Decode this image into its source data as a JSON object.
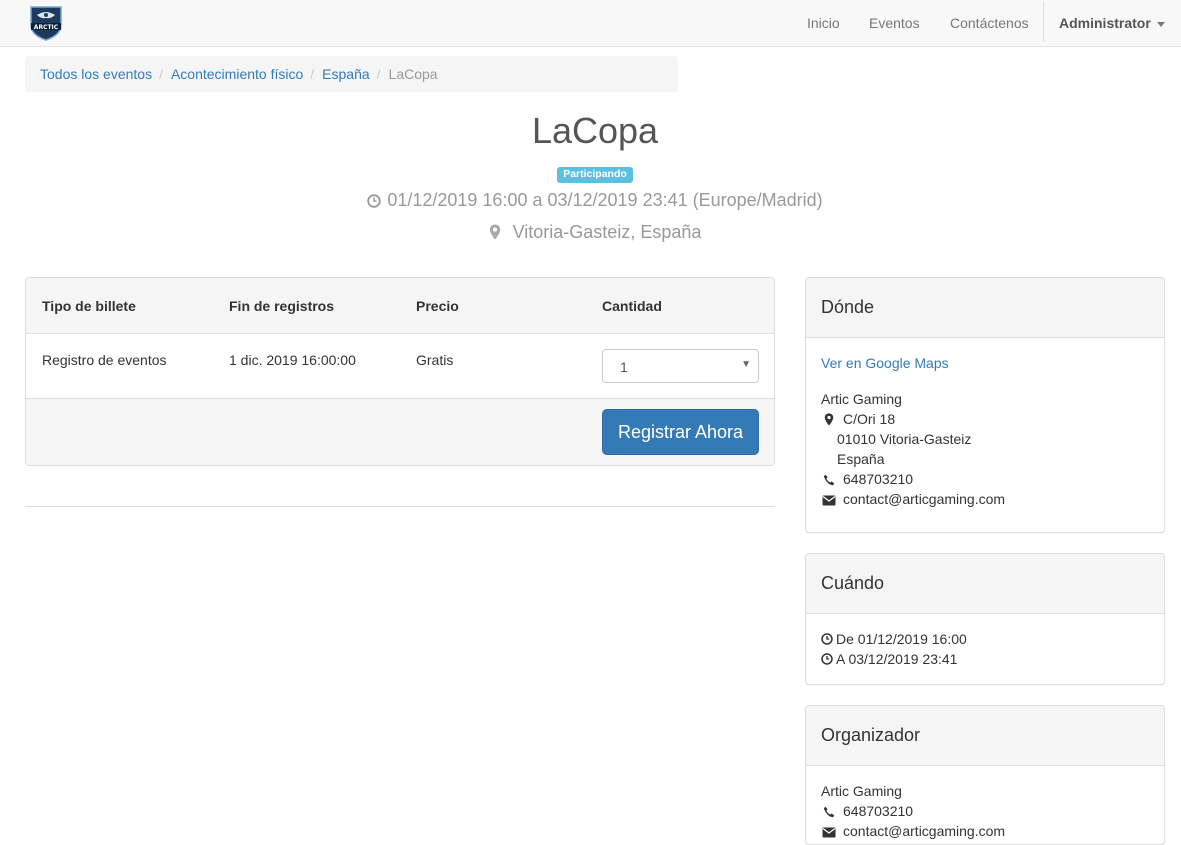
{
  "navbar": {
    "logo_text": "ARCTIC",
    "links": [
      "Inicio",
      "Eventos",
      "Contáctenos"
    ],
    "user_menu": "Administrator"
  },
  "breadcrumb": {
    "items": [
      "Todos los eventos",
      "Acontecimiento físico",
      "España"
    ],
    "active": "LaCopa",
    "separator": "/"
  },
  "event": {
    "title": "LaCopa",
    "status_badge": "Participando",
    "dates": "01/12/2019 16:00 a 03/12/2019 23:41 (Europe/Madrid)",
    "location": "Vitoria-Gasteiz, España"
  },
  "tickets": {
    "headers": [
      "Tipo de billete",
      "Fin de registros",
      "Precio",
      "Cantidad"
    ],
    "row": {
      "type": "Registro de eventos",
      "end": "1 dic. 2019 16:00:00",
      "price": "Gratis",
      "quantity": "1"
    },
    "register_label": "Registrar Ahora"
  },
  "where": {
    "title": "Dónde",
    "maps_link": "Ver en Google Maps",
    "name": "Artic Gaming",
    "street": "C/Ori 18",
    "city": "01010 Vitoria-Gasteiz",
    "country": "España",
    "phone": "648703210",
    "email": "contact@articgaming.com"
  },
  "when": {
    "title": "Cuándo",
    "from": "De 01/12/2019 16:00",
    "to": "A 03/12/2019 23:41"
  },
  "organizer": {
    "title": "Organizador",
    "name": "Artic Gaming",
    "phone": "648703210",
    "email": "contact@articgaming.com"
  },
  "colors": {
    "primary": "#337ab7",
    "badge": "#5bc0de",
    "muted": "#999999",
    "panel_bg": "#f5f5f5"
  }
}
